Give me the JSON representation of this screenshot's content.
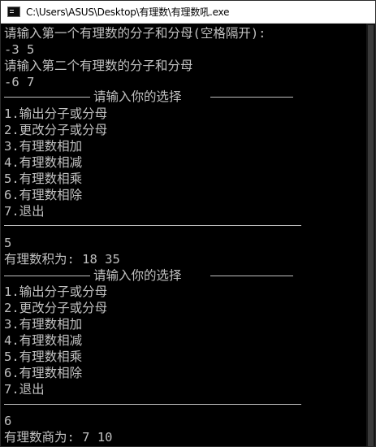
{
  "window": {
    "title": "C:\\Users\\ASUS\\Desktop\\有理数\\有理数吼.exe"
  },
  "console": {
    "lines": [
      "请输入第一个有理数的分子和分母(空格隔开):",
      "-3 5",
      "请输入第二个有理数的分子和分母",
      "-6 7",
      "请输入你的选择",
      "1.输出分子或分母",
      "2.更改分子或分母",
      "3.有理数相加",
      "4.有理数相减",
      "5.有理数相乘",
      "6.有理数相除",
      "7.退出",
      "5",
      "有理数积为: 18 35",
      "请输入你的选择",
      "1.输出分子或分母",
      "2.更改分子或分母",
      "3.有理数相加",
      "4.有理数相减",
      "5.有理数相乘",
      "6.有理数相除",
      "7.退出",
      "6",
      "有理数商为: 7 10"
    ]
  },
  "colors": {
    "console_background": "#000000",
    "console_text": "#c0c0c0",
    "titlebar_background": "#ffffff"
  }
}
